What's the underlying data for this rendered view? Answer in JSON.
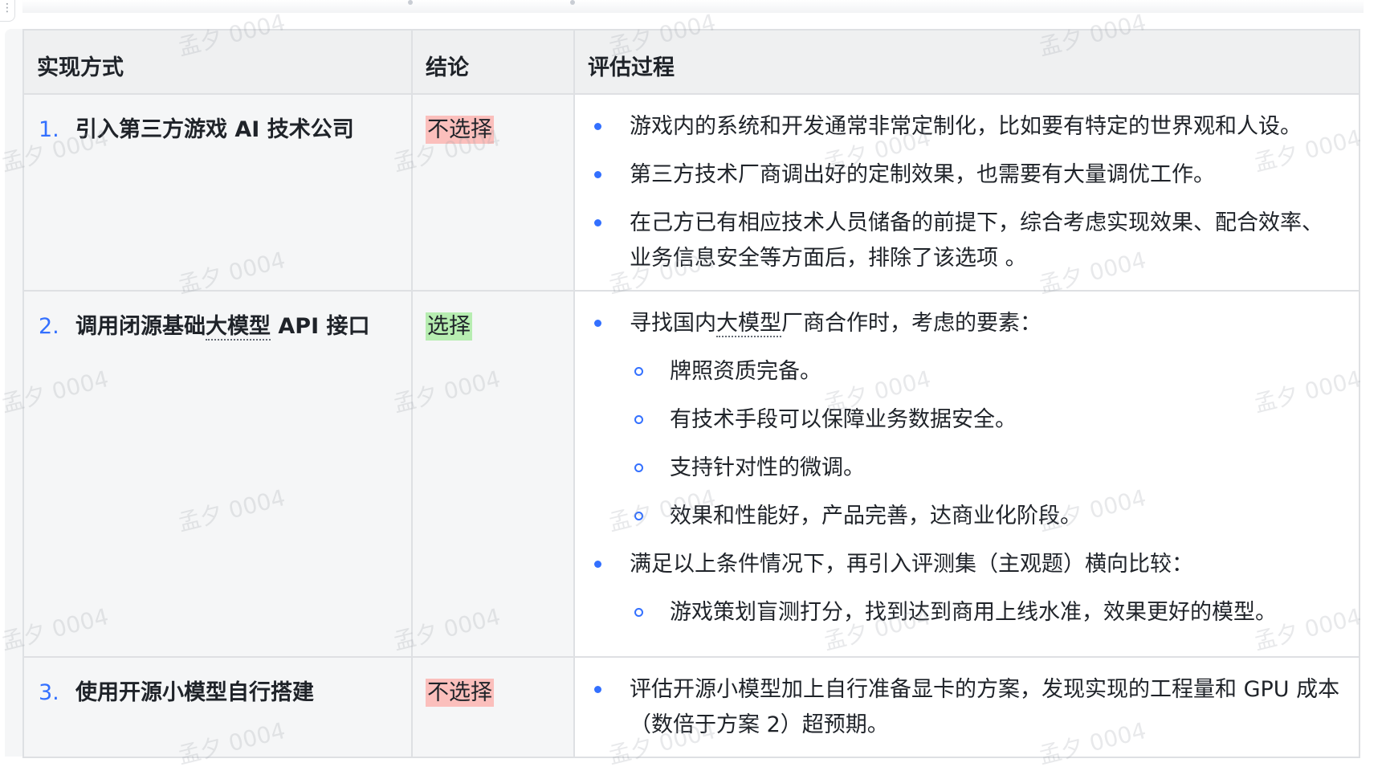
{
  "table": {
    "headers": [
      "实现方式",
      "结论",
      "评估过程"
    ],
    "rows": [
      {
        "num": "1.",
        "method": "引入第三方游戏 AI 技术公司",
        "verdict": "不选择",
        "bullets": [
          "游戏内的系统和开发通常非常定制化，比如要有特定的世界观和人设。",
          "第三方技术厂商调出好的定制效果，也需要有大量调优工作。",
          "在己方已有相应技术人员储备的前提下，综合考虑实现效果、配合效率、业务信息安全等方面后，排除了该选项 。"
        ]
      },
      {
        "num": "2.",
        "method_pre": "调用闭源基础",
        "method_term": "大模型",
        "method_post": " API 接口",
        "verdict": "选择",
        "b1_pre": "寻找国内",
        "b1_term": "大模型",
        "b1_post": "厂商合作时，考虑的要素：",
        "b1_subs": [
          "牌照资质完备。",
          "有技术手段可以保障业务数据安全。",
          "支持针对性的微调。",
          "效果和性能好，产品完善，达商业化阶段。"
        ],
        "b2": "满足以上条件情况下，再引入评测集（主观题）横向比较：",
        "b2_subs": [
          "游戏策划盲测打分，找到达到商用上线水准，效果更好的模型。"
        ]
      },
      {
        "num": "3.",
        "method": "使用开源小模型自行搭建",
        "verdict": "不选择",
        "bullets": [
          "评估开源小模型加上自行准备显卡的方案，发现实现的工程量和 GPU 成本（数倍于方案 2）超预期。"
        ]
      }
    ]
  },
  "watermark": "孟夕 0004",
  "colors": {
    "accent": "#3370ff",
    "highlight_red": "#fbbfbc",
    "highlight_green": "#b7edb1",
    "header_bg": "#eff0f1",
    "border": "#dee0e3"
  }
}
